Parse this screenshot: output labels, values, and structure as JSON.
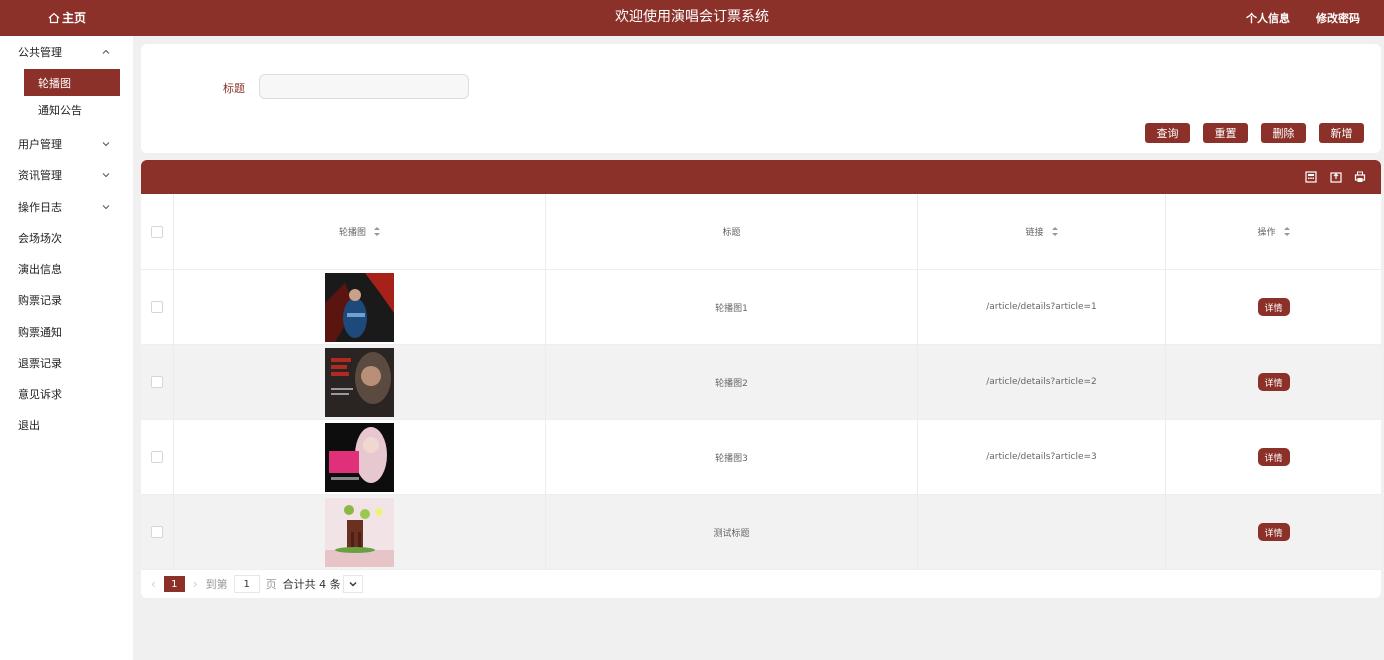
{
  "header": {
    "home_label": "主页",
    "title": "欢迎使用演唱会订票系统",
    "links": [
      "个人信息",
      "修改密码"
    ]
  },
  "sidebar": {
    "items": [
      {
        "label": "公共管理",
        "expanded": true,
        "children": [
          {
            "label": "轮播图",
            "active": true
          },
          {
            "label": "通知公告"
          }
        ]
      },
      {
        "label": "用户管理",
        "expanded": false
      },
      {
        "label": "资讯管理",
        "expanded": false
      },
      {
        "label": "操作日志",
        "expanded": false
      },
      {
        "label": "会场场次"
      },
      {
        "label": "演出信息"
      },
      {
        "label": "购票记录"
      },
      {
        "label": "购票通知"
      },
      {
        "label": "退票记录"
      },
      {
        "label": "意见诉求"
      },
      {
        "label": "退出"
      }
    ]
  },
  "search": {
    "label": "标题",
    "value": "",
    "buttons": [
      "查询",
      "重置",
      "删除",
      "新增"
    ]
  },
  "table": {
    "toolbar_icons": [
      "calculator-icon",
      "export-icon",
      "print-icon"
    ],
    "columns": [
      "轮播图",
      "标题",
      "链接",
      "操作"
    ],
    "rows": [
      {
        "title": "轮播图1",
        "link": "/article/details?article=1",
        "action": "详情"
      },
      {
        "title": "轮播图2",
        "link": "/article/details?article=2",
        "action": "详情"
      },
      {
        "title": "轮播图3",
        "link": "/article/details?article=3",
        "action": "详情"
      },
      {
        "title": "测试标题",
        "link": "",
        "action": "详情"
      }
    ]
  },
  "pagination": {
    "current_page": "1",
    "goto_label": "到第",
    "goto_value": "1",
    "page_suffix": "页",
    "total_text": "合计共 4 条"
  },
  "colors": {
    "accent": "#8b312a"
  }
}
